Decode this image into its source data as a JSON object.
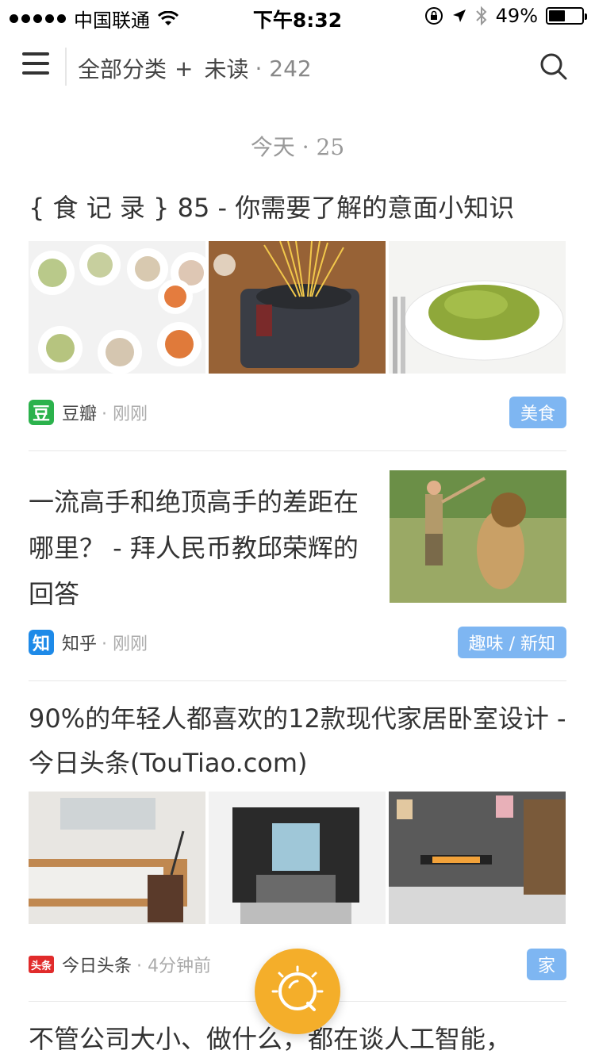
{
  "status_bar": {
    "carrier": "中国联通",
    "time": "下午8:32",
    "battery_text": "49%",
    "battery_level": 0.49
  },
  "nav": {
    "category": "全部分类",
    "plus": "+",
    "filter": "未读",
    "count": "· 242"
  },
  "section": {
    "label": "今天 · 25"
  },
  "articles": [
    {
      "title": "{ 食 记 录 } 85 - 你需要了解的意面小知识",
      "source": "豆瓣",
      "source_icon_text": "豆",
      "source_color": "#2bb24c",
      "time": "· 刚刚",
      "tag": "美食",
      "thumb_icons": [
        "pasta-plates-image",
        "spaghetti-pot-image",
        "green-pasta-image"
      ]
    },
    {
      "title": "一流高手和绝顶高手的差距在哪里？ - 拜人民币教邱荣辉的回答",
      "source": "知乎",
      "source_icon_text": "知",
      "source_color": "#1e8ae8",
      "time": "· 刚刚",
      "tag": "趣味 / 新知",
      "thumb_icons": [
        "lion-trainer-image"
      ]
    },
    {
      "title": "90%的年轻人都喜欢的12款现代家居卧室设计 - 今日头条(TouTiao.com)",
      "source": "今日头条",
      "source_icon_text": "头条",
      "source_color": "#e12b2b",
      "time": "· 4分钟前",
      "tag": "家",
      "thumb_icons": [
        "bedroom-1-image",
        "bedroom-2-image",
        "bedroom-3-image"
      ]
    },
    {
      "title": "不管公司大小、做什么，都在谈人工智能，"
    }
  ],
  "colors": {
    "tag_bg": "#7eb6f2",
    "fab": "#f4ae2a"
  }
}
